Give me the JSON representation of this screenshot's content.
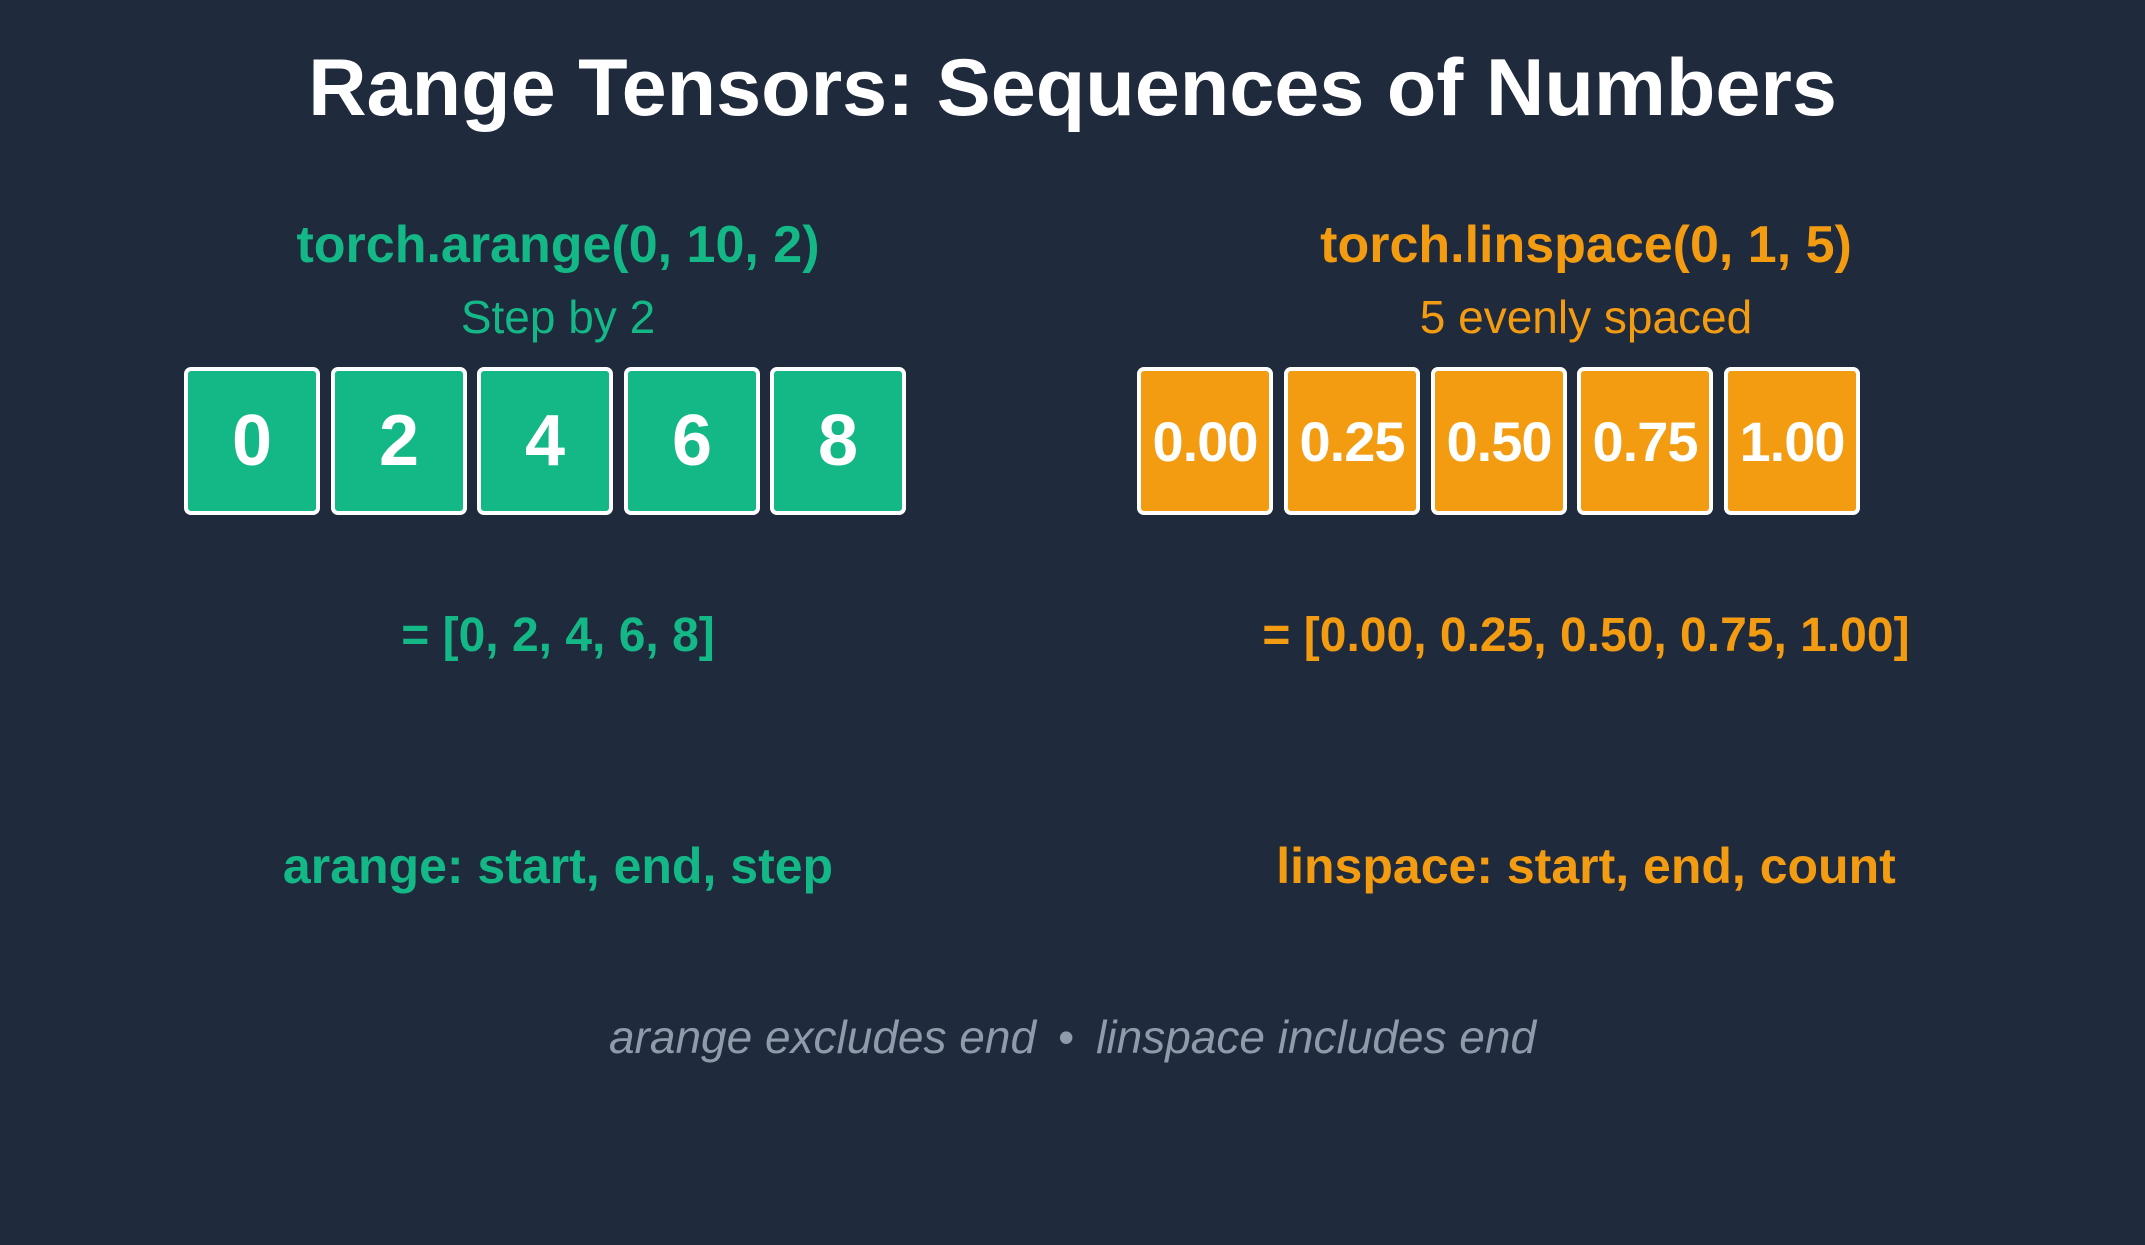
{
  "title": "Range Tensors: Sequences of Numbers",
  "left": {
    "function": "torch.arange(0, 10, 2)",
    "subtitle": "Step by 2",
    "values": [
      "0",
      "2",
      "4",
      "6",
      "8"
    ],
    "result": "= [0, 2, 4, 6, 8]",
    "signature": "arange: start, end, step",
    "color": "#14b886"
  },
  "right": {
    "function": "torch.linspace(0, 1, 5)",
    "subtitle": "5 evenly spaced",
    "values": [
      "0.00",
      "0.25",
      "0.50",
      "0.75",
      "1.00"
    ],
    "result": "= [0.00, 0.25, 0.50, 0.75, 1.00]",
    "signature": "linspace: start, end, count",
    "color": "#f39c12"
  },
  "footer": {
    "left_note": "arange excludes end",
    "separator": "•",
    "right_note": "linspace includes end"
  }
}
